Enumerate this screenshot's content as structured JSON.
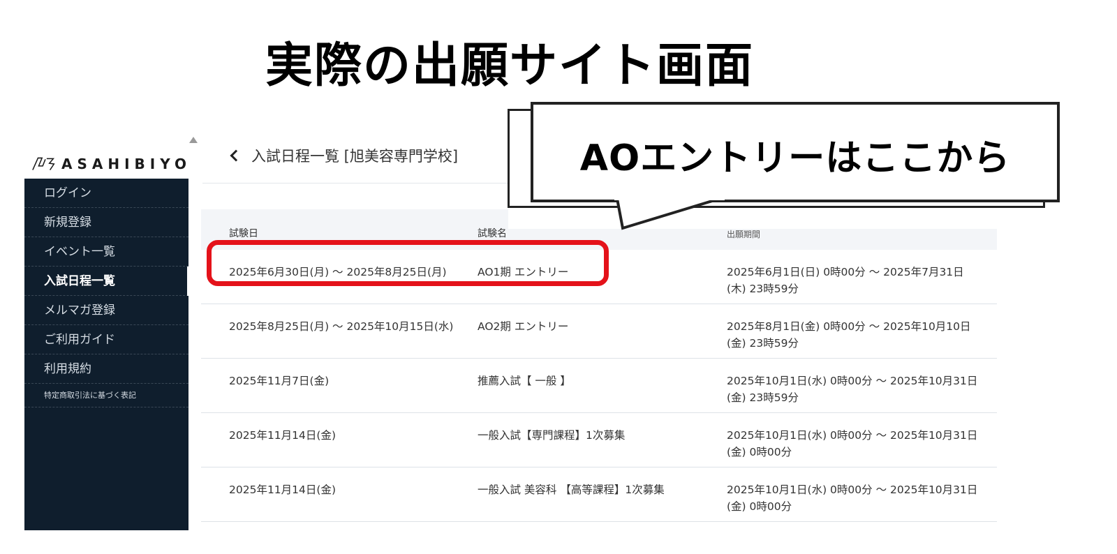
{
  "slide": {
    "title": "実際の出願サイト画面"
  },
  "logo": {
    "text": "ASAHIBIYO"
  },
  "sidebar": {
    "items": [
      {
        "label": "ログイン"
      },
      {
        "label": "新規登録"
      },
      {
        "label": "イベント一覧"
      },
      {
        "label": "入試日程一覧",
        "active": true
      },
      {
        "label": "メルマガ登録"
      },
      {
        "label": "ご利用ガイド"
      },
      {
        "label": "利用規約"
      },
      {
        "label": "特定商取引法に基づく表記"
      }
    ]
  },
  "page": {
    "heading": "入試日程一覧 [旭美容専門学校]"
  },
  "table": {
    "headers": {
      "date": "試験日",
      "name": "試験名",
      "period": "出願期間"
    },
    "rows": [
      {
        "date": "2025年6月30日(月) ～ 2025年8月25日(月)",
        "name": "AO1期 エントリー",
        "period": "2025年6月1日(日) 0時00分 ～ 2025年7月31日(木) 23時59分"
      },
      {
        "date": "2025年8月25日(月) ～ 2025年10月15日(水)",
        "name": "AO2期 エントリー",
        "period": "2025年8月1日(金) 0時00分 ～ 2025年10月10日(金) 23時59分"
      },
      {
        "date": "2025年11月7日(金)",
        "name": "推薦入試【 一般 】",
        "period": "2025年10月1日(水) 0時00分 ～ 2025年10月31日(金) 23時59分"
      },
      {
        "date": "2025年11月14日(金)",
        "name": "一般入試【専門課程】1次募集",
        "period": "2025年10月1日(水) 0時00分 ～ 2025年10月31日(金) 0時00分"
      },
      {
        "date": "2025年11月14日(金)",
        "name": "一般入試 美容科 【高等課程】1次募集",
        "period": "2025年10月1日(水) 0時00分 ～ 2025年10月31日(金) 0時00分"
      }
    ]
  },
  "callout": {
    "text": "AOエントリーはここから"
  },
  "colors": {
    "sidebar_bg": "#0f1e2d",
    "highlight": "#e4121a"
  }
}
